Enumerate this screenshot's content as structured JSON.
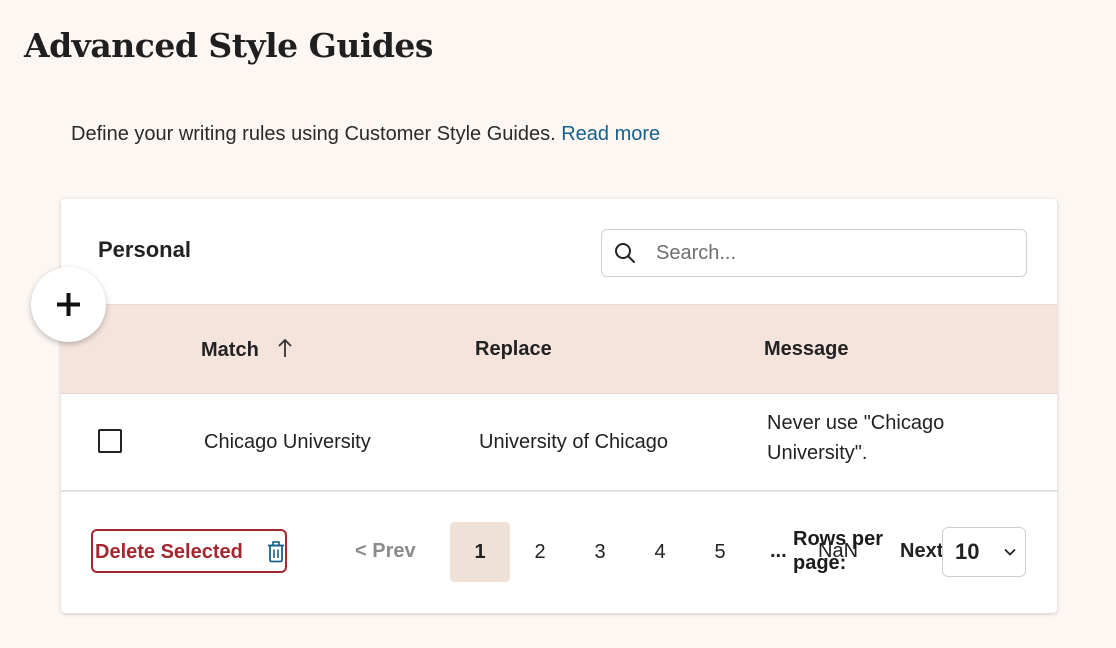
{
  "page": {
    "title": "Advanced Style Guides",
    "intro_text": "Define your writing rules using Customer Style Guides.",
    "read_more_label": "Read more"
  },
  "card": {
    "section_title": "Personal",
    "search": {
      "placeholder": "Search...",
      "value": "",
      "icon": "search-icon"
    },
    "add_button": {
      "icon": "plus-icon"
    }
  },
  "table": {
    "columns": [
      {
        "label": "Match",
        "sort": "ascending",
        "sort_icon": "arrow-up-icon"
      },
      {
        "label": "Replace"
      },
      {
        "label": "Message"
      }
    ],
    "rows": [
      {
        "checked": false,
        "match": "Chicago University",
        "replace": "University of Chicago",
        "message": "Never use \"Chicago University\"."
      }
    ]
  },
  "footer": {
    "delete_label": "Delete Selected",
    "delete_icon": "trash-icon",
    "prev_label": "< Prev",
    "pages": [
      "1",
      "2",
      "3",
      "4",
      "5"
    ],
    "current_page": "1",
    "ellipsis": "...",
    "nan_label": "NaN",
    "rows_per_page_label": "Rows per page:",
    "next_label": "Next",
    "rows_per_page_value": "10"
  },
  "colors": {
    "background": "#fdf7f4",
    "table_header": "#f4e4dc",
    "active_page": "#efe0d8",
    "link": "#17608a",
    "danger": "#a3272f"
  }
}
